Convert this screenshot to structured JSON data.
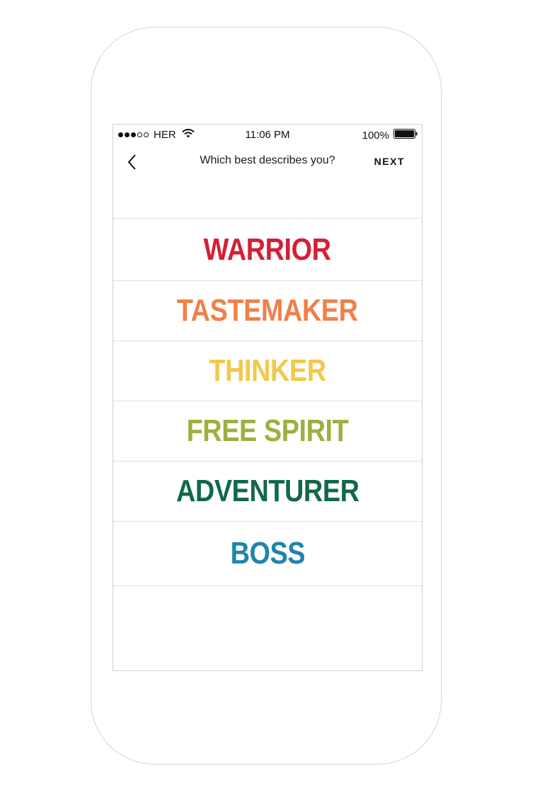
{
  "status_bar": {
    "carrier": "HER",
    "time": "11:06 PM",
    "battery_percent": "100%",
    "signal_bars_filled": 3,
    "signal_bars_total": 5
  },
  "nav": {
    "back_icon": "chevron-left-icon",
    "title": "Which best describes you?",
    "next_label": "NEXT"
  },
  "options": [
    {
      "label": "WARRIOR",
      "color": "#d41f35"
    },
    {
      "label": "TASTEMAKER",
      "color": "#f08048"
    },
    {
      "label": "THINKER",
      "color": "#f2c84b"
    },
    {
      "label": "FREE SPIRIT",
      "color": "#9daf3f"
    },
    {
      "label": "ADVENTURER",
      "color": "#116847"
    },
    {
      "label": "BOSS",
      "color": "#1f84ad"
    }
  ]
}
